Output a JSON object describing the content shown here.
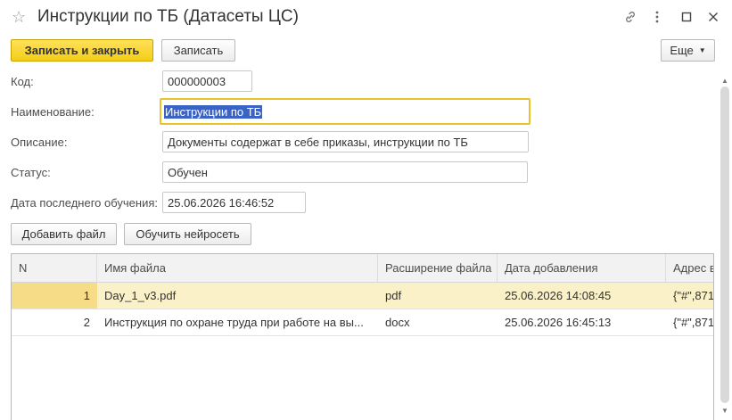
{
  "window": {
    "title": "Инструкции по ТБ (Датасеты ЦС)"
  },
  "toolbar": {
    "save_close_label": "Записать и закрыть",
    "save_label": "Записать",
    "more_label": "Еще"
  },
  "form": {
    "code_label": "Код:",
    "code_value": "000000003",
    "name_label": "Наименование:",
    "name_value": "Инструкции по ТБ",
    "description_label": "Описание:",
    "description_value": "Документы содержат в себе приказы, инструкции по ТБ",
    "status_label": "Статус:",
    "status_value": "Обучен",
    "last_training_label": "Дата последнего обучения:",
    "last_training_value": "25.06.2026 16:46:52"
  },
  "actions": {
    "add_file_label": "Добавить файл",
    "train_label": "Обучить нейросеть"
  },
  "table": {
    "columns": [
      "N",
      "Имя файла",
      "Расширение файла",
      "Дата добавления",
      "Адрес в"
    ],
    "rows": [
      {
        "n": "1",
        "file": "Day_1_v3.pdf",
        "ext": "pdf",
        "date": "25.06.2026 14:08:45",
        "addr": "{\"#\",871"
      },
      {
        "n": "2",
        "file": "Инструкция по охране труда при работе на вы...",
        "ext": "docx",
        "date": "25.06.2026 16:45:13",
        "addr": "{\"#\",871"
      }
    ],
    "selected_row": 0
  },
  "icons": {
    "favorite": "star-icon",
    "link": "link-icon",
    "more": "more-icon",
    "maximize": "maximize-icon",
    "close": "close-icon"
  },
  "colors": {
    "primary_button": "#f5cd16",
    "focus_border": "#e8c32a",
    "selection": "#3a63c5",
    "selected_row": "#fbf1c9"
  }
}
